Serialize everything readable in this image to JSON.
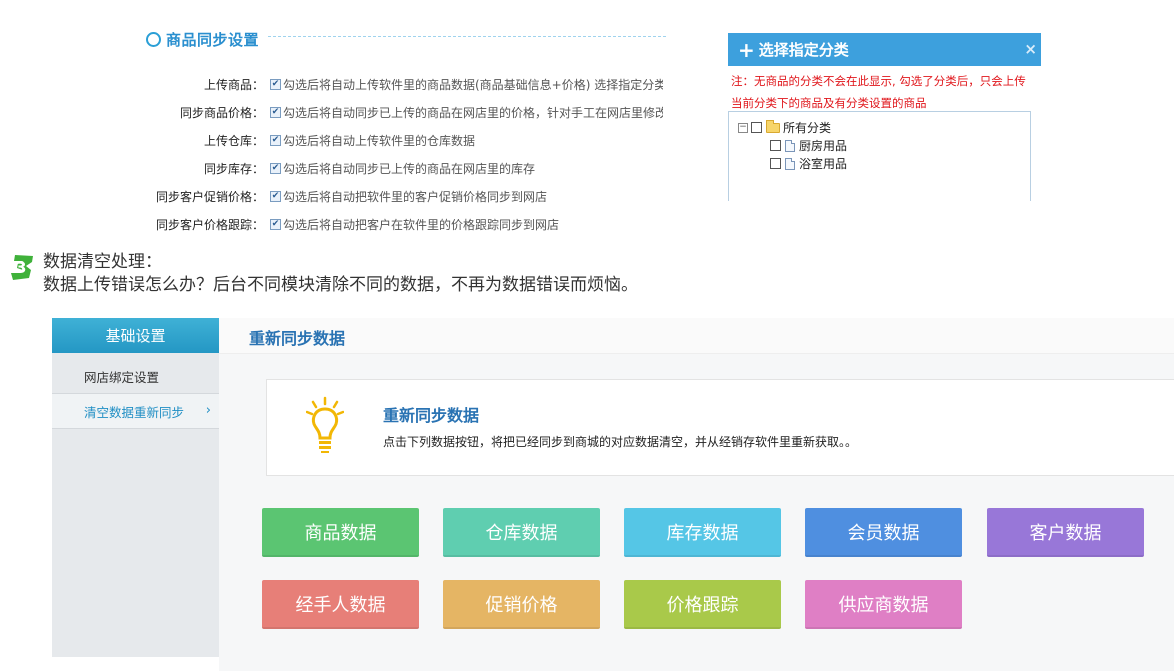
{
  "sync_settings": {
    "title": "商品同步设置",
    "options": [
      {
        "label": "上传商品：",
        "desc": "勾选后将自动上传软件里的商品数据(商品基础信息+价格)  选择指定分类"
      },
      {
        "label": "同步商品价格：",
        "desc": "勾选后将自动同步已上传的商品在网店里的价格，针对手工在网店里修改"
      },
      {
        "label": "上传仓库：",
        "desc": "勾选后将自动上传软件里的仓库数据"
      },
      {
        "label": "同步库存：",
        "desc": "勾选后将自动同步已上传的商品在网店里的库存"
      },
      {
        "label": "同步客户促销价格：",
        "desc": "勾选后将自动把软件里的客户促销价格同步到网店"
      },
      {
        "label": "同步客户价格跟踪：",
        "desc": "勾选后将自动把客户在软件里的价格跟踪同步到网店"
      }
    ],
    "checked_mark": "✔"
  },
  "category_dialog": {
    "title": "选择指定分类",
    "plus": "+",
    "close": "×",
    "note_line1": "注：无商品的分类不会在此显示, 勾选了分类后，只会上传",
    "note_line2": "当前分类下的商品及有分类设置的商品",
    "tree": {
      "root": "所有分类",
      "toggle": "−",
      "children": [
        "厨房用品",
        "浴室用品"
      ]
    }
  },
  "step3": {
    "badge": "3",
    "title": "数据清空处理：",
    "desc": "数据上传错误怎么办？后台不同模块清除不同的数据，不再为数据错误而烦恼。"
  },
  "admin": {
    "sidebar": {
      "header": "基础设置",
      "items": [
        {
          "label": "网店绑定设置"
        },
        {
          "label": "清空数据重新同步"
        }
      ],
      "chevron": "›"
    },
    "main_title": "重新同步数据",
    "card": {
      "title": "重新同步数据",
      "desc": "点击下列数据按钮，将把已经同步到商城的对应数据清空，并从经销存软件里重新获取。。"
    },
    "buttons": [
      {
        "label": "商品数据",
        "color": "#5bc572"
      },
      {
        "label": "仓库数据",
        "color": "#5fceb0"
      },
      {
        "label": "库存数据",
        "color": "#55c6e6"
      },
      {
        "label": "会员数据",
        "color": "#4f8fe0"
      },
      {
        "label": "客户数据",
        "color": "#9877d8"
      },
      {
        "label": "经手人数据",
        "color": "#e77f78"
      },
      {
        "label": "促销价格",
        "color": "#e5b564"
      },
      {
        "label": "价格跟踪",
        "color": "#a9c94a"
      },
      {
        "label": "供应商数据",
        "color": "#df7fc5"
      }
    ]
  }
}
